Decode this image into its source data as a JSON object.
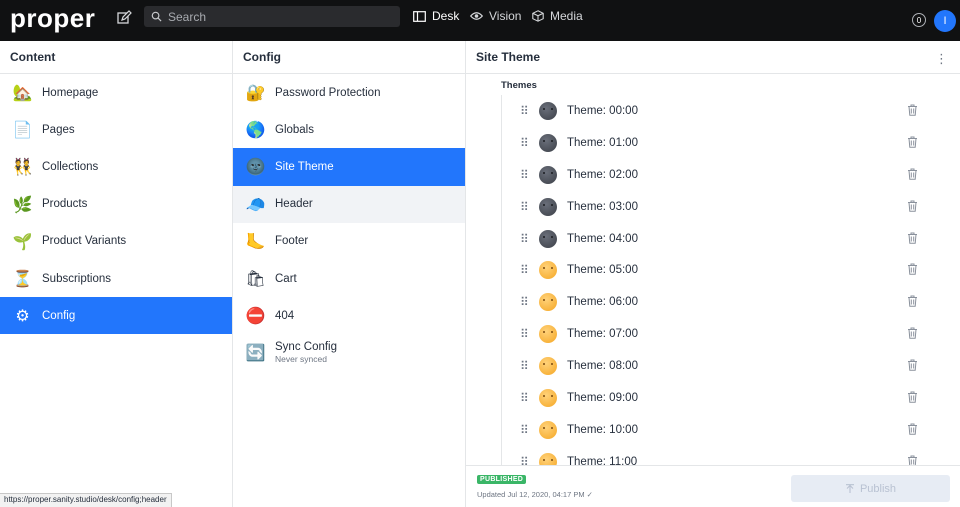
{
  "app": {
    "logo": "proper",
    "search": {
      "placeholder": "Search"
    },
    "tools": [
      {
        "label": "Desk",
        "icon": "desk-icon",
        "active": true
      },
      {
        "label": "Vision",
        "icon": "eye-icon",
        "active": false
      },
      {
        "label": "Media",
        "icon": "cube-icon",
        "active": false
      }
    ],
    "notifications": "0",
    "avatar_initial": "I",
    "accent": "#2276fc"
  },
  "content_pane": {
    "title": "Content",
    "items": [
      {
        "label": "Homepage",
        "emoji": "🏡"
      },
      {
        "label": "Pages",
        "emoji": "📄"
      },
      {
        "label": "Collections",
        "emoji": "👯"
      },
      {
        "label": "Products",
        "emoji": "🌿"
      },
      {
        "label": "Product Variants",
        "emoji": "🌱"
      },
      {
        "label": "Subscriptions",
        "emoji": "⏳"
      },
      {
        "label": "Config",
        "emoji": "⚙"
      }
    ]
  },
  "config_pane": {
    "title": "Config",
    "items": [
      {
        "label": "Password Protection",
        "emoji": "🔐"
      },
      {
        "label": "Globals",
        "emoji": "🌎"
      },
      {
        "label": "Site Theme",
        "emoji": "🌚"
      },
      {
        "label": "Header",
        "emoji": "🧢"
      },
      {
        "label": "Footer",
        "emoji": "🦶"
      },
      {
        "label": "Cart",
        "emoji": "🛍"
      },
      {
        "label": "404",
        "emoji": "⛔"
      },
      {
        "label": "Sync Config",
        "emoji": "🔄",
        "sub": "Never synced"
      }
    ]
  },
  "doc_pane": {
    "title": "Site Theme",
    "field_label": "Themes",
    "themes": [
      {
        "label": "Theme: 00:00",
        "mode": "night"
      },
      {
        "label": "Theme: 01:00",
        "mode": "night"
      },
      {
        "label": "Theme: 02:00",
        "mode": "night"
      },
      {
        "label": "Theme: 03:00",
        "mode": "night"
      },
      {
        "label": "Theme: 04:00",
        "mode": "night"
      },
      {
        "label": "Theme: 05:00",
        "mode": "day"
      },
      {
        "label": "Theme: 06:00",
        "mode": "day"
      },
      {
        "label": "Theme: 07:00",
        "mode": "day"
      },
      {
        "label": "Theme: 08:00",
        "mode": "day"
      },
      {
        "label": "Theme: 09:00",
        "mode": "day"
      },
      {
        "label": "Theme: 10:00",
        "mode": "day"
      },
      {
        "label": "Theme: 11:00",
        "mode": "day"
      }
    ],
    "status_badge": "PUBLISHED",
    "updated": "Updated Jul 12, 2020, 04:17 PM ✓",
    "publish_label": "Publish"
  },
  "status_url": "https://proper.sanity.studio/desk/config;header"
}
